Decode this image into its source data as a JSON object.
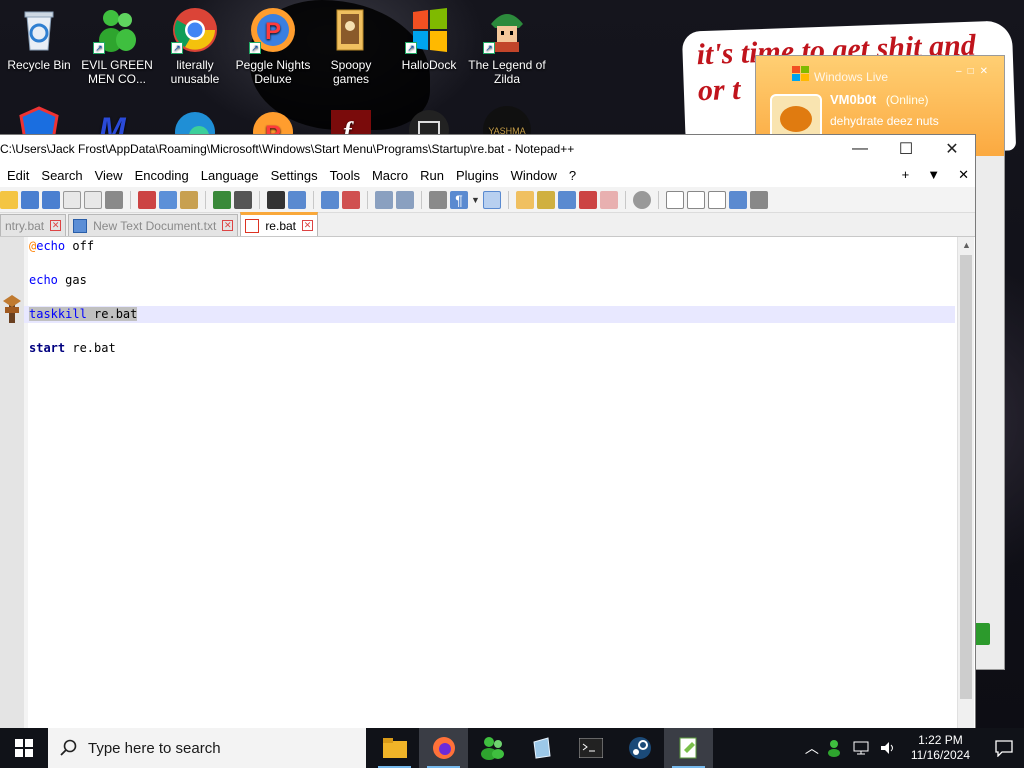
{
  "desktop": {
    "icons": [
      {
        "label": "Recycle Bin",
        "icon": "recycle-bin-icon"
      },
      {
        "label": "EVIL GREEN MEN CO...",
        "icon": "green-men-icon"
      },
      {
        "label": "literally unusable",
        "icon": "chrome-icon"
      },
      {
        "label": "Peggle Nights Deluxe",
        "icon": "peggle-icon"
      },
      {
        "label": "Spoopy games",
        "icon": "folder-icon"
      },
      {
        "label": "HalloDock",
        "icon": "windows-logo-icon"
      },
      {
        "label": "The Legend of Zilda",
        "icon": "zilda-icon"
      }
    ],
    "sticker_text": "it's time to get shit and or t",
    "yashma_label": "YASHMA"
  },
  "windows_live": {
    "brand": "Windows Live",
    "name": "VM0b0t",
    "status": "(Online)",
    "message": "dehydrate deez nuts"
  },
  "notepad": {
    "title": "C:\\Users\\Jack Frost\\AppData\\Roaming\\Microsoft\\Windows\\Start Menu\\Programs\\Startup\\re.bat - Notepad++",
    "menu": [
      "Edit",
      "Search",
      "View",
      "Encoding",
      "Language",
      "Settings",
      "Tools",
      "Macro",
      "Run",
      "Plugins",
      "Window",
      "?"
    ],
    "menu_right": [
      "+",
      "▼",
      "✕"
    ],
    "tabs": [
      {
        "label": "ntry.bat",
        "active": false
      },
      {
        "label": "New Text Document.txt",
        "active": false
      },
      {
        "label": "re.bat",
        "active": true
      }
    ],
    "code": {
      "l1_at": "@",
      "l1_kw": "echo",
      "l1_rest": " off",
      "l3_kw": "echo",
      "l3_rest": " gas",
      "l5_kw": "taskkill",
      "l5_rest": " re.bat",
      "l7_kw": "start",
      "l7_rest": " re.bat"
    }
  },
  "taskbar": {
    "search_placeholder": "Type here to search",
    "time": "1:22 PM",
    "date": "11/16/2024",
    "apps": [
      "file-explorer-icon",
      "firefox-icon",
      "messenger-icon",
      "notes-icon",
      "terminal-icon",
      "steam-icon",
      "notepadpp-icon"
    ]
  },
  "colors": {
    "accent": "#f9a83a",
    "keyword": "#0000ff",
    "taskbar": "#101218"
  }
}
